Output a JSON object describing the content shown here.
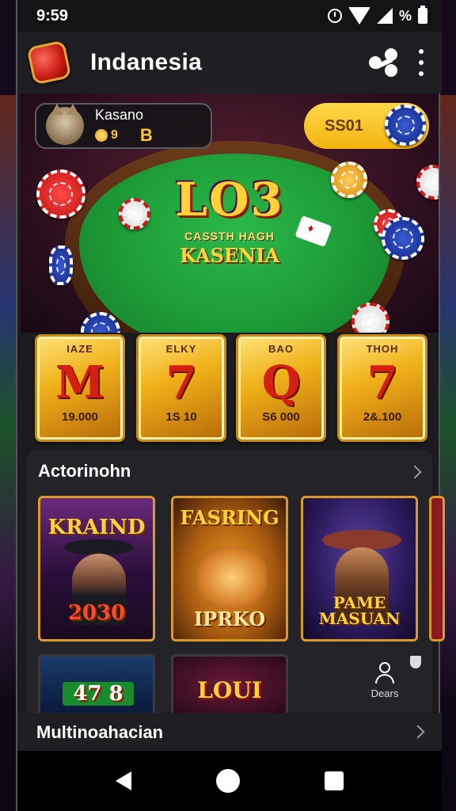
{
  "status_bar": {
    "time": "9:59",
    "battery_label": "%"
  },
  "app_bar": {
    "title": "Indanesia"
  },
  "user": {
    "name": "Kasano",
    "coins": "9",
    "bag_label": "B"
  },
  "balance": {
    "amount": "SS01"
  },
  "hero": {
    "logo_text": "LO3",
    "subtitle1": "CASSTH HAGH",
    "subtitle2": "KASENIA"
  },
  "slots": [
    {
      "tag": "IAZE",
      "symbol": "M",
      "amount": "19.000"
    },
    {
      "tag": "ELKY",
      "symbol": "7",
      "amount": "1S 10"
    },
    {
      "tag": "BAO",
      "symbol": "Q",
      "amount": "S6 000"
    },
    {
      "tag": "THOH",
      "symbol": "7",
      "amount": "2&.100"
    }
  ],
  "section": {
    "title": "Actorinohn",
    "games": [
      {
        "title": "KRAIND",
        "sub": "2030"
      },
      {
        "title": "FASRING",
        "sub": "IPRKO"
      },
      {
        "title": "PAME MASUAN",
        "sub": ""
      }
    ],
    "row2": [
      {
        "title": "47 8"
      },
      {
        "title": "LOUI"
      }
    ],
    "profile_label": "Dears"
  },
  "section2": {
    "title": "Multinoahacian"
  },
  "colors": {
    "accent": "#ffc72a",
    "felt": "#1d9a36",
    "background": "#1c1c20"
  }
}
